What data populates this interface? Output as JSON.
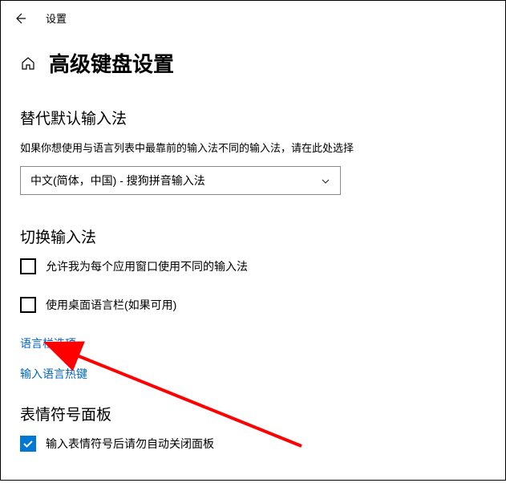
{
  "header": {
    "title": "设置"
  },
  "page": {
    "title": "高级键盘设置"
  },
  "section1": {
    "title": "替代默认输入法",
    "desc": "如果你想使用与语言列表中最靠前的输入法不同的输入法，请在此处选择",
    "dropdown_value": "中文(简体，中国) - 搜狗拼音输入法"
  },
  "section2": {
    "title": "切换输入法",
    "checkbox1_label": "允许我为每个应用窗口使用不同的输入法",
    "checkbox2_label": "使用桌面语言栏(如果可用)",
    "link1": "语言栏选项",
    "link2": "输入语言热键"
  },
  "section3": {
    "title": "表情符号面板",
    "checkbox_label": "输入表情符号后请勿自动关闭面板"
  }
}
